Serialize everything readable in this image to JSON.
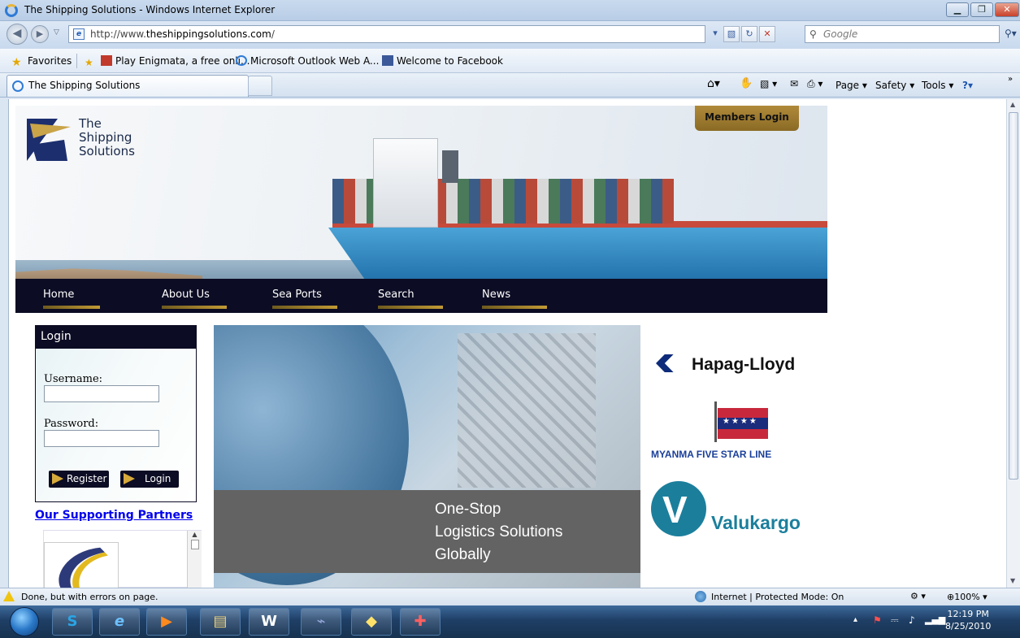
{
  "window": {
    "title": "The Shipping Solutions - Windows Internet Explorer"
  },
  "address": {
    "url_prefix": "http://www.",
    "url_domain": "theshippingsolutions.com",
    "url_suffix": "/",
    "search_placeholder": "Google"
  },
  "favorites": {
    "label": "Favorites",
    "items": [
      "Play Enigmata, a free onli...",
      "Microsoft Outlook Web A...",
      "Welcome to Facebook"
    ]
  },
  "tabs": [
    {
      "label": "The Shipping Solutions"
    }
  ],
  "commandbar": {
    "page": "Page",
    "safety": "Safety",
    "tools": "Tools"
  },
  "site": {
    "logo_lines": [
      "The",
      "Shipping",
      "Solutions"
    ],
    "members_login": "Members Login",
    "nav": [
      "Home",
      "About Us",
      "Sea Ports",
      "Search",
      "News"
    ],
    "login": {
      "title": "Login",
      "username_label": "Username:",
      "password_label": "Password:",
      "register_button": "Register",
      "login_button": "Login"
    },
    "partners_link": "Our Supporting Partners",
    "hero_caption": [
      "One-Stop",
      "Logistics Solutions",
      "Globally"
    ],
    "partner_logos": {
      "hapag": "Hapag-Lloyd",
      "myanma": "MYANMA FIVE STAR LINE",
      "valukargo": "Valukargo"
    }
  },
  "status": {
    "message": "Done, but with errors on page.",
    "zone": "Internet | Protected Mode: On",
    "zoom": "100%"
  },
  "taskbar": {
    "time": "12:19 PM",
    "date": "8/25/2010"
  },
  "colors": {
    "nav_bg": "#0c0c24",
    "accent_gold": "#c29a35",
    "link": "#0000ee"
  }
}
